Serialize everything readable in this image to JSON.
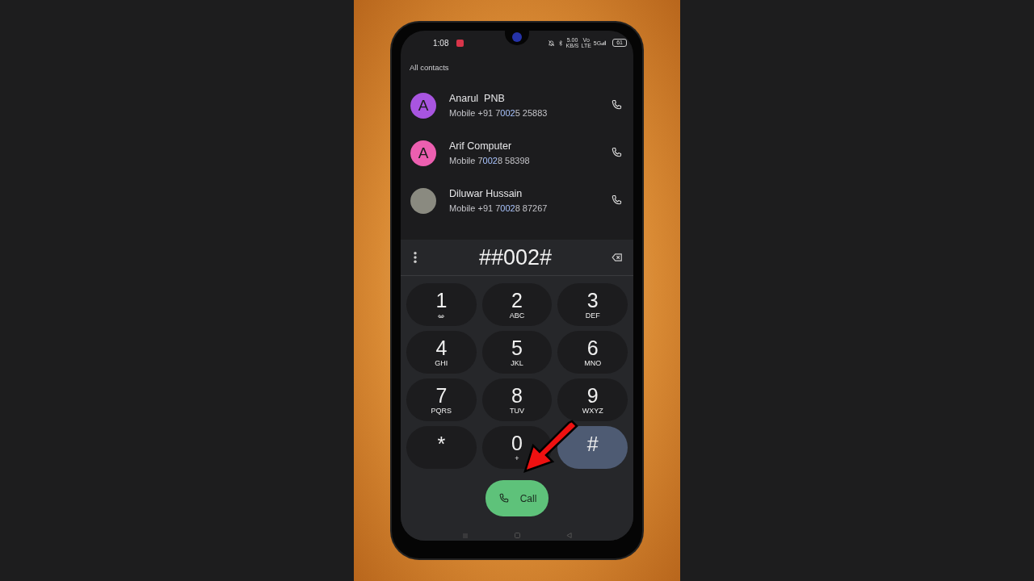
{
  "status_bar": {
    "time": "1:08",
    "net_speed": "5.00",
    "net_unit": "KB/S",
    "volte": "Vo",
    "lte": "LTE",
    "network": "5G",
    "battery": "61"
  },
  "section_title": "All contacts",
  "contacts": [
    {
      "name": "Anarul  PNB",
      "detail": "Mobile +91 7**002**5 25883",
      "kind": "letter",
      "initial": "A",
      "color": "#a855e0"
    },
    {
      "name": "Arif Computer",
      "detail": "Mobile 7**002**8 58398",
      "kind": "letter",
      "initial": "A",
      "color": "#ec5fb0"
    },
    {
      "name": "Diluwar Hussain",
      "detail": "Mobile +91 7**002**8 87267",
      "kind": "photo"
    }
  ],
  "dialer": {
    "number": "##002#",
    "keys": [
      {
        "digit": "1",
        "kind": "voicemail",
        "selected": false
      },
      {
        "digit": "2",
        "letters": "ABC",
        "kind": "letters",
        "selected": false
      },
      {
        "digit": "3",
        "letters": "DEF",
        "kind": "letters",
        "selected": false
      },
      {
        "digit": "4",
        "letters": "GHI",
        "kind": "letters",
        "selected": false
      },
      {
        "digit": "5",
        "letters": "JKL",
        "kind": "letters",
        "selected": false
      },
      {
        "digit": "6",
        "letters": "MNO",
        "kind": "letters",
        "selected": false
      },
      {
        "digit": "7",
        "letters": "PQRS",
        "kind": "letters",
        "selected": false
      },
      {
        "digit": "8",
        "letters": "TUV",
        "kind": "letters",
        "selected": false
      },
      {
        "digit": "9",
        "letters": "WXYZ",
        "kind": "letters",
        "selected": false
      },
      {
        "digit": "*",
        "kind": "symbol",
        "selected": false
      },
      {
        "digit": "0",
        "letters": "+",
        "kind": "letters",
        "selected": false
      },
      {
        "digit": "#",
        "kind": "symbol",
        "selected": true
      }
    ]
  },
  "call_button": {
    "label": "Call"
  }
}
